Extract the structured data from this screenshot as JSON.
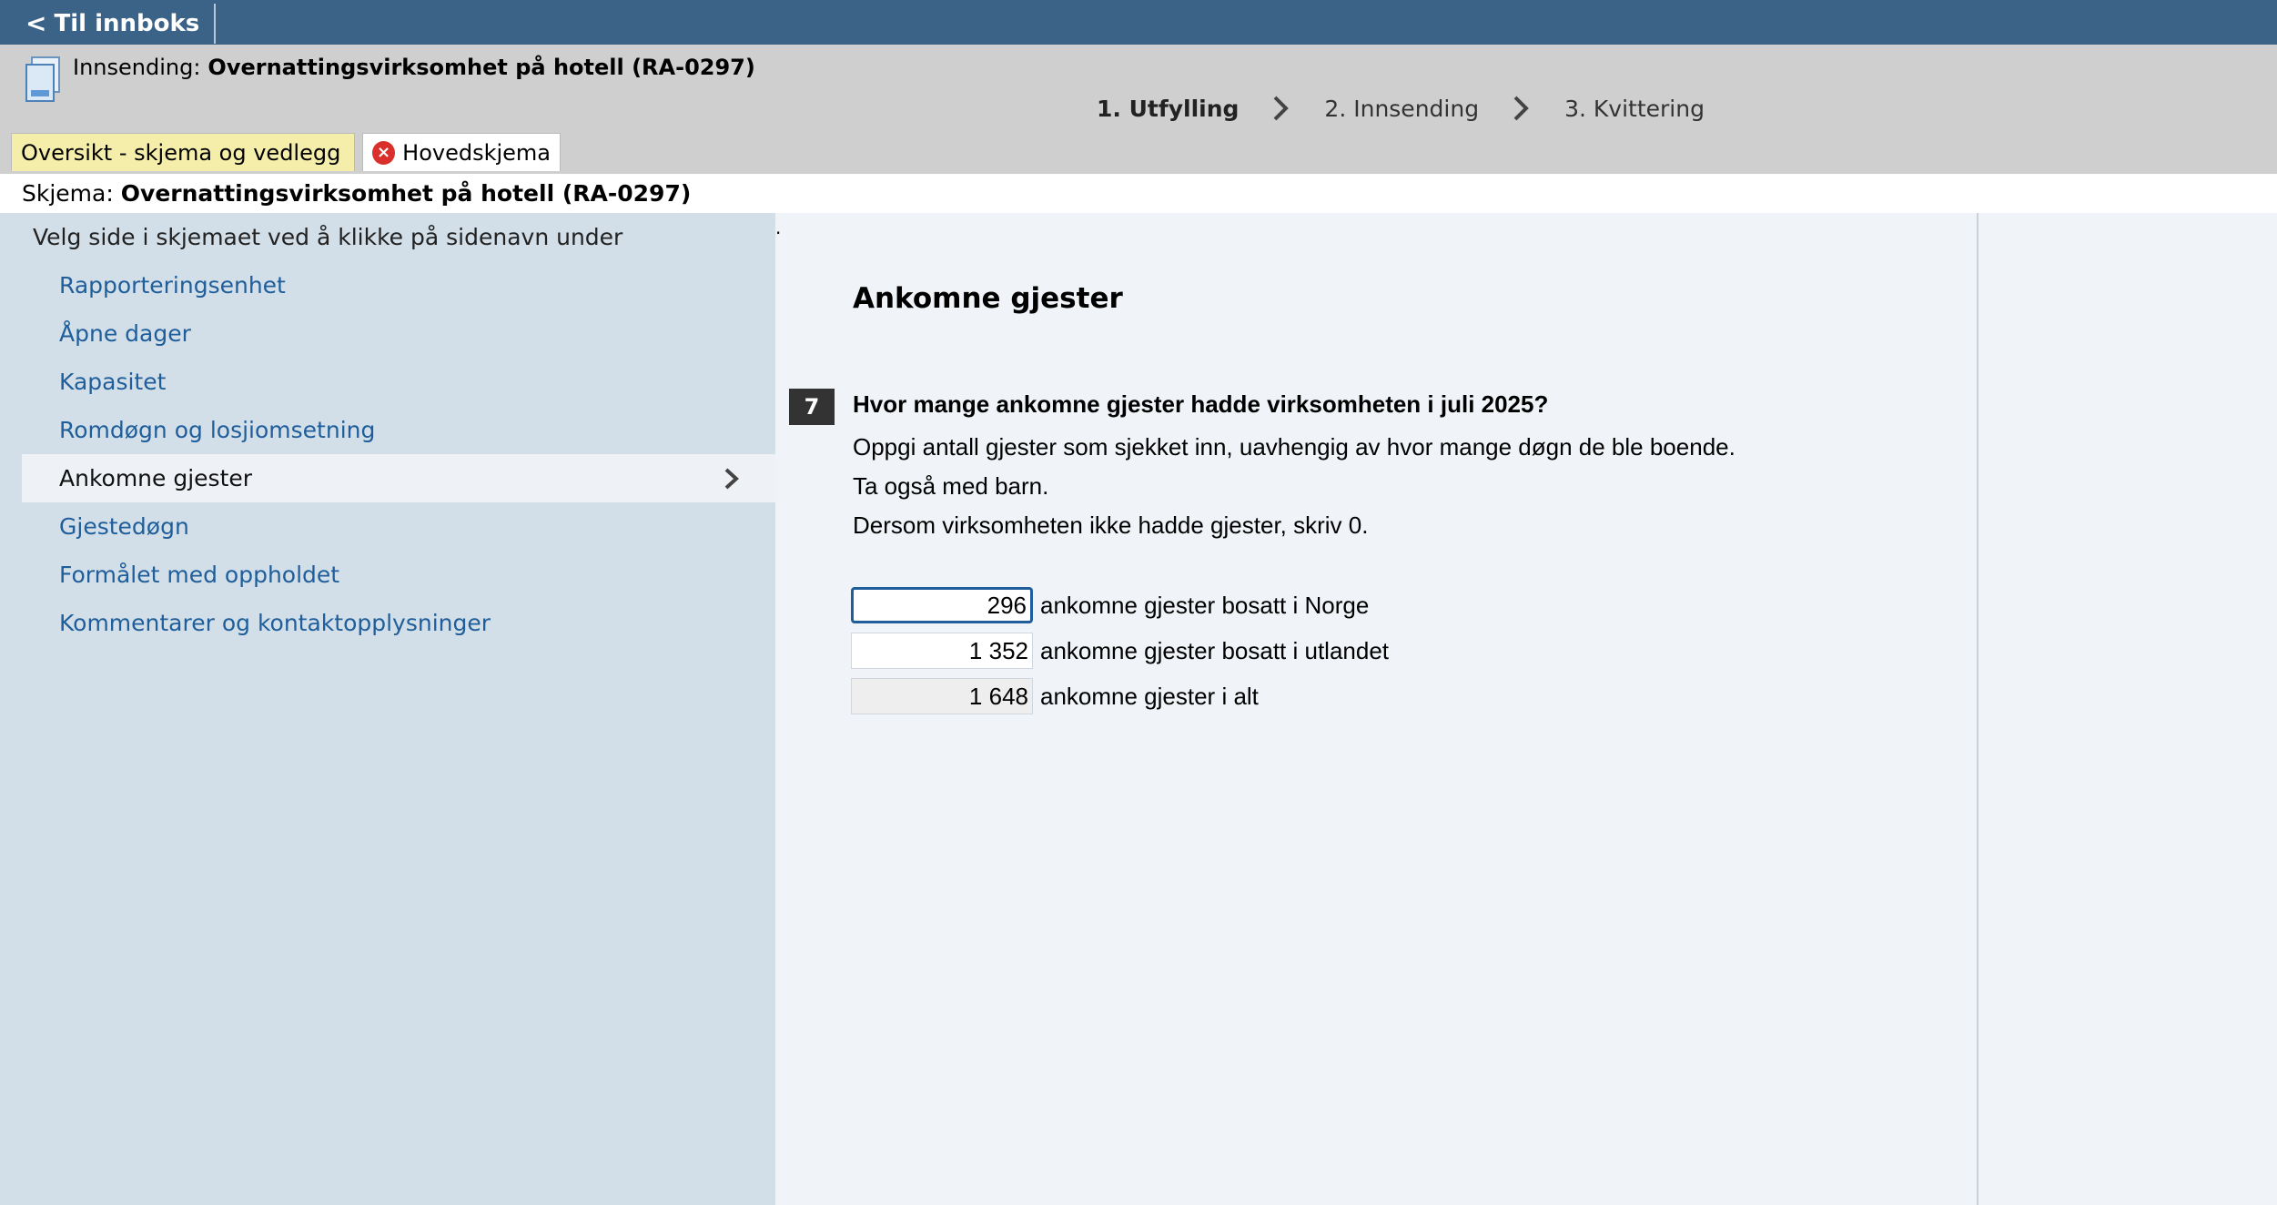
{
  "topbar": {
    "back_label": "Til innboks"
  },
  "header": {
    "submission_prefix": "Innsending:",
    "submission_title": "Overnattingsvirksomhet på hotell (RA-0297)",
    "steps": [
      "1. Utfylling",
      "2. Innsending",
      "3. Kvittering"
    ],
    "tabs": {
      "overview": "Oversikt - skjema og vedlegg",
      "main": "Hovedskjema"
    }
  },
  "schema": {
    "prefix": "Skjema:",
    "title": "Overnattingsvirksomhet på hotell (RA-0297)"
  },
  "sidebar": {
    "hint": "Velg side i skjemaet ved å klikke på sidenavn under",
    "items": [
      {
        "label": "Rapporteringsenhet"
      },
      {
        "label": "Åpne dager"
      },
      {
        "label": "Kapasitet"
      },
      {
        "label": "Romdøgn og losjiomsetning"
      },
      {
        "label": "Ankomne gjester"
      },
      {
        "label": "Gjestedøgn"
      },
      {
        "label": "Formålet med oppholdet"
      },
      {
        "label": "Kommentarer og kontaktopplysninger"
      }
    ],
    "active_index": 4
  },
  "main": {
    "section_title": "Ankomne gjester",
    "question_number": "7",
    "question": "Hvor mange ankomne gjester hadde virksomheten i juli 2025?",
    "help": [
      "Oppgi antall gjester som sjekket inn, uavhengig av hvor mange døgn de ble boende.",
      "Ta også med barn.",
      "Dersom virksomheten ikke hadde gjester, skriv 0."
    ],
    "fields": [
      {
        "value": "296",
        "label": "ankomne gjester bosatt i Norge"
      },
      {
        "value": "1 352",
        "label": "ankomne gjester bosatt i utlandet"
      },
      {
        "value": "1 648",
        "label": "ankomne gjester i alt"
      }
    ]
  },
  "colors": {
    "topbar": "#3b6387",
    "link": "#1f5e9a",
    "sidebar": "#d2dfe8",
    "error": "#d9302b"
  },
  "icons": {
    "back": "chevron-left-icon",
    "document": "document-icon",
    "error": "error-icon",
    "step_separator": "chevron-right-icon"
  }
}
